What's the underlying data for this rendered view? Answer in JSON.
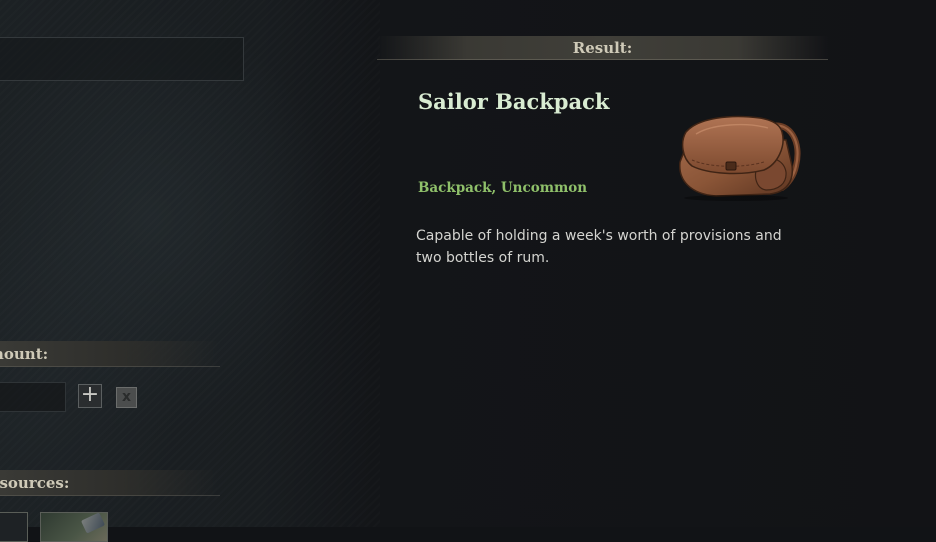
{
  "left_panel": {
    "amount_label": "mount:",
    "plus_button": "+",
    "clear_button": "x",
    "resources_label": "resources:"
  },
  "result": {
    "header": "Result:",
    "item_name": "Sailor Backpack",
    "item_type": "Backpack, Uncommon",
    "item_description": "Capable of holding a week's worth of provisions and two bottles of rum.",
    "item_icon": "leather-backpack-icon"
  },
  "colors": {
    "item_name": "#d9ecd2",
    "item_type": "#8fc06a",
    "header_text": "#cfcab8",
    "background": "#111316"
  }
}
